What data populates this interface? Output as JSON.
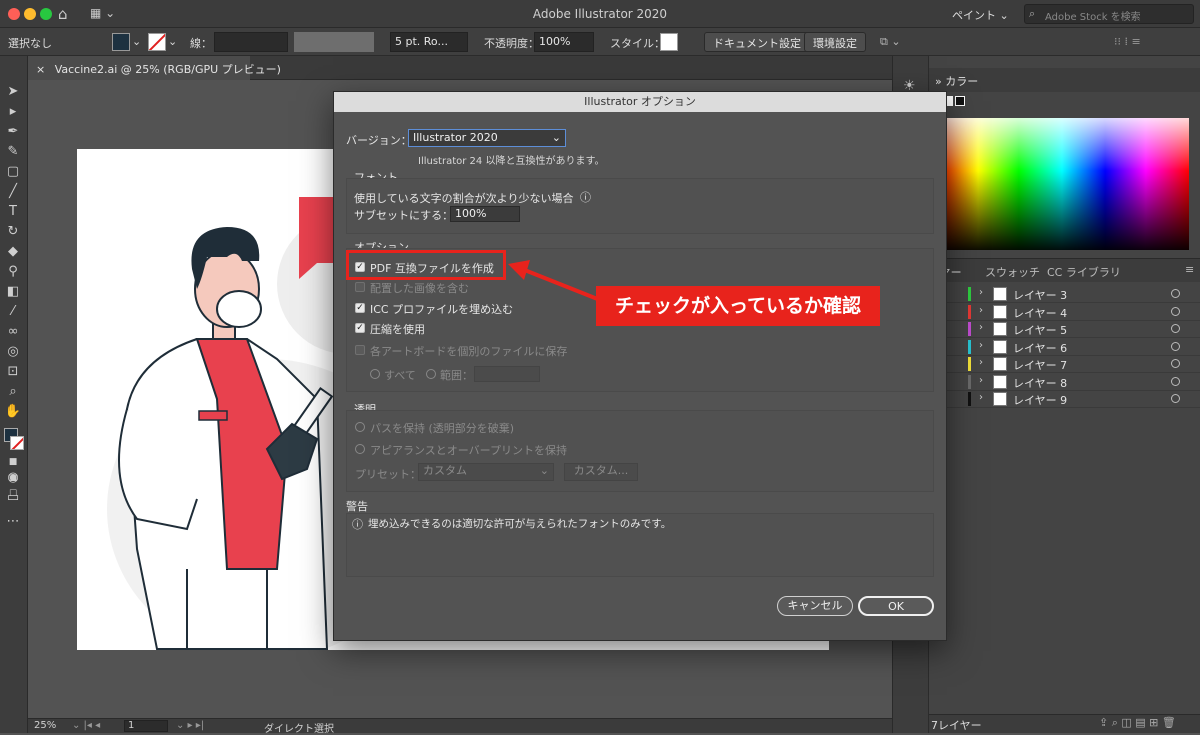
{
  "window": {
    "app_title": "Adobe Illustrator 2020",
    "workspace": "ペイント",
    "stock_search_placeholder": "Adobe Stock を検索"
  },
  "control_bar": {
    "selection": "選択なし",
    "stroke_label": "線：",
    "brush": "5 pt. Ro...",
    "opacity_label": "不透明度：",
    "opacity_value": "100%",
    "style_label": "スタイル：",
    "doc_settings": "ドキュメント設定",
    "preferences": "環境設定"
  },
  "document_tab": {
    "title": "Vaccine2.ai @ 25% (RGB/GPU プレビュー)",
    "close": "×"
  },
  "status_bar": {
    "zoom": "25%",
    "artboard": "1",
    "tool": "ダイレクト選択"
  },
  "panels": {
    "color_tab": "カラー",
    "layers_tab": "イヤー",
    "swatches_tab": "スウォッチ",
    "cc_tab": "CC ライブラリ",
    "layers": [
      {
        "name": "レイヤー 3",
        "color": "#2ecc40"
      },
      {
        "name": "レイヤー 4",
        "color": "#e53935"
      },
      {
        "name": "レイヤー 5",
        "color": "#c04dd0"
      },
      {
        "name": "レイヤー 6",
        "color": "#29c5d3"
      },
      {
        "name": "レイヤー 7",
        "color": "#f2e13a"
      },
      {
        "name": "レイヤー 8",
        "color": "#6a6a6a"
      },
      {
        "name": "レイヤー 9",
        "color": "#111111"
      }
    ],
    "layers_count": "7レイヤー"
  },
  "dialog": {
    "title": "Illustrator オプション",
    "version_label": "バージョン：",
    "version_value": "Illustrator 2020",
    "version_note": "Illustrator 24 以降と互換性があります。",
    "font_group": "フォント",
    "font_subset_line1": "使用している文字の割合が次より少ない場合",
    "font_subset_line2": "サブセットにする：",
    "font_subset_value": "100%",
    "options_group": "オプション",
    "opt_pdf": "PDF 互換ファイルを作成",
    "opt_linked": "配置した画像を含む",
    "opt_icc": "ICC プロファイルを埋め込む",
    "opt_compress": "圧縮を使用",
    "opt_artboards": "各アートボードを個別のファイルに保存",
    "opt_all": "すべて",
    "opt_range": "範囲：",
    "transparency_group": "透明",
    "trans_paths": "パスを保持 (透明部分を破棄)",
    "trans_appearance": "アピアランスとオーバープリントを保持",
    "preset_label": "プリセット：",
    "preset_value": "カスタム",
    "preset_button": "カスタム...",
    "warning_group": "警告",
    "warning_text": "埋め込みできるのは適切な許可が与えられたフォントのみです。",
    "cancel": "キャンセル",
    "ok": "OK"
  },
  "annotation": {
    "callout": "チェックが入っているか確認"
  }
}
